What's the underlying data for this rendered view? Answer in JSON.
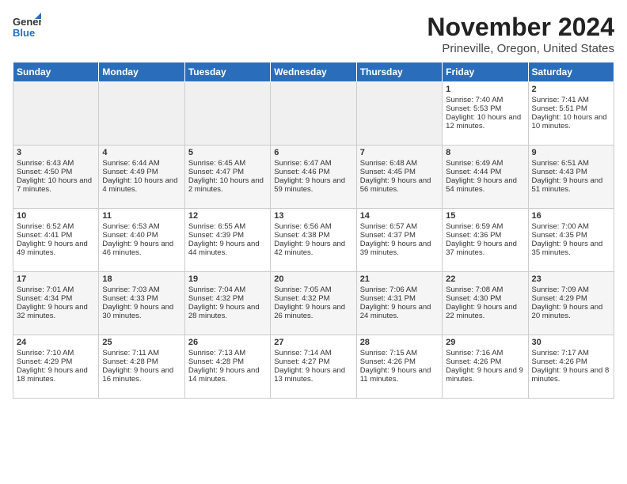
{
  "header": {
    "logo_general": "General",
    "logo_blue": "Blue",
    "month_title": "November 2024",
    "location": "Prineville, Oregon, United States"
  },
  "weekdays": [
    "Sunday",
    "Monday",
    "Tuesday",
    "Wednesday",
    "Thursday",
    "Friday",
    "Saturday"
  ],
  "weeks": [
    [
      {
        "day": "",
        "info": ""
      },
      {
        "day": "",
        "info": ""
      },
      {
        "day": "",
        "info": ""
      },
      {
        "day": "",
        "info": ""
      },
      {
        "day": "",
        "info": ""
      },
      {
        "day": "1",
        "info": "Sunrise: 7:40 AM\nSunset: 5:53 PM\nDaylight: 10 hours and 12 minutes."
      },
      {
        "day": "2",
        "info": "Sunrise: 7:41 AM\nSunset: 5:51 PM\nDaylight: 10 hours and 10 minutes."
      }
    ],
    [
      {
        "day": "3",
        "info": "Sunrise: 6:43 AM\nSunset: 4:50 PM\nDaylight: 10 hours and 7 minutes."
      },
      {
        "day": "4",
        "info": "Sunrise: 6:44 AM\nSunset: 4:49 PM\nDaylight: 10 hours and 4 minutes."
      },
      {
        "day": "5",
        "info": "Sunrise: 6:45 AM\nSunset: 4:47 PM\nDaylight: 10 hours and 2 minutes."
      },
      {
        "day": "6",
        "info": "Sunrise: 6:47 AM\nSunset: 4:46 PM\nDaylight: 9 hours and 59 minutes."
      },
      {
        "day": "7",
        "info": "Sunrise: 6:48 AM\nSunset: 4:45 PM\nDaylight: 9 hours and 56 minutes."
      },
      {
        "day": "8",
        "info": "Sunrise: 6:49 AM\nSunset: 4:44 PM\nDaylight: 9 hours and 54 minutes."
      },
      {
        "day": "9",
        "info": "Sunrise: 6:51 AM\nSunset: 4:43 PM\nDaylight: 9 hours and 51 minutes."
      }
    ],
    [
      {
        "day": "10",
        "info": "Sunrise: 6:52 AM\nSunset: 4:41 PM\nDaylight: 9 hours and 49 minutes."
      },
      {
        "day": "11",
        "info": "Sunrise: 6:53 AM\nSunset: 4:40 PM\nDaylight: 9 hours and 46 minutes."
      },
      {
        "day": "12",
        "info": "Sunrise: 6:55 AM\nSunset: 4:39 PM\nDaylight: 9 hours and 44 minutes."
      },
      {
        "day": "13",
        "info": "Sunrise: 6:56 AM\nSunset: 4:38 PM\nDaylight: 9 hours and 42 minutes."
      },
      {
        "day": "14",
        "info": "Sunrise: 6:57 AM\nSunset: 4:37 PM\nDaylight: 9 hours and 39 minutes."
      },
      {
        "day": "15",
        "info": "Sunrise: 6:59 AM\nSunset: 4:36 PM\nDaylight: 9 hours and 37 minutes."
      },
      {
        "day": "16",
        "info": "Sunrise: 7:00 AM\nSunset: 4:35 PM\nDaylight: 9 hours and 35 minutes."
      }
    ],
    [
      {
        "day": "17",
        "info": "Sunrise: 7:01 AM\nSunset: 4:34 PM\nDaylight: 9 hours and 32 minutes."
      },
      {
        "day": "18",
        "info": "Sunrise: 7:03 AM\nSunset: 4:33 PM\nDaylight: 9 hours and 30 minutes."
      },
      {
        "day": "19",
        "info": "Sunrise: 7:04 AM\nSunset: 4:32 PM\nDaylight: 9 hours and 28 minutes."
      },
      {
        "day": "20",
        "info": "Sunrise: 7:05 AM\nSunset: 4:32 PM\nDaylight: 9 hours and 26 minutes."
      },
      {
        "day": "21",
        "info": "Sunrise: 7:06 AM\nSunset: 4:31 PM\nDaylight: 9 hours and 24 minutes."
      },
      {
        "day": "22",
        "info": "Sunrise: 7:08 AM\nSunset: 4:30 PM\nDaylight: 9 hours and 22 minutes."
      },
      {
        "day": "23",
        "info": "Sunrise: 7:09 AM\nSunset: 4:29 PM\nDaylight: 9 hours and 20 minutes."
      }
    ],
    [
      {
        "day": "24",
        "info": "Sunrise: 7:10 AM\nSunset: 4:29 PM\nDaylight: 9 hours and 18 minutes."
      },
      {
        "day": "25",
        "info": "Sunrise: 7:11 AM\nSunset: 4:28 PM\nDaylight: 9 hours and 16 minutes."
      },
      {
        "day": "26",
        "info": "Sunrise: 7:13 AM\nSunset: 4:28 PM\nDaylight: 9 hours and 14 minutes."
      },
      {
        "day": "27",
        "info": "Sunrise: 7:14 AM\nSunset: 4:27 PM\nDaylight: 9 hours and 13 minutes."
      },
      {
        "day": "28",
        "info": "Sunrise: 7:15 AM\nSunset: 4:26 PM\nDaylight: 9 hours and 11 minutes."
      },
      {
        "day": "29",
        "info": "Sunrise: 7:16 AM\nSunset: 4:26 PM\nDaylight: 9 hours and 9 minutes."
      },
      {
        "day": "30",
        "info": "Sunrise: 7:17 AM\nSunset: 4:26 PM\nDaylight: 9 hours and 8 minutes."
      }
    ]
  ]
}
